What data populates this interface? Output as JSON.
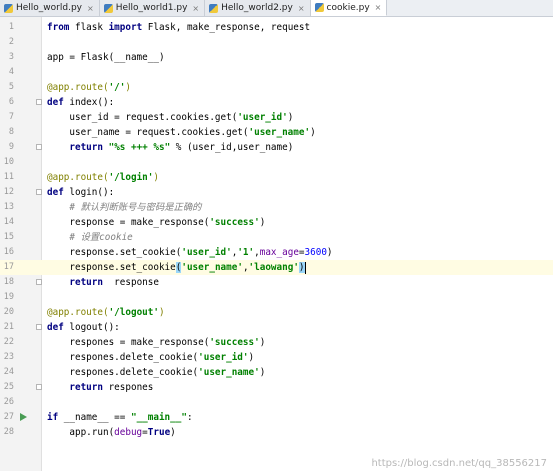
{
  "tabs": [
    {
      "label": "Hello_world.py",
      "active": false
    },
    {
      "label": "Hello_world1.py",
      "active": false
    },
    {
      "label": "Hello_world2.py",
      "active": false
    },
    {
      "label": "cookie.py",
      "active": true
    }
  ],
  "tab_close_glyph": "×",
  "icons": {
    "file_tab": "python-file-icon",
    "run": "run-arrow-icon",
    "fold": "fold-marker-icon"
  },
  "current_line": 17,
  "lines": [
    {
      "n": "1",
      "tokens": [
        {
          "t": "from",
          "c": "kw"
        },
        {
          "t": " flask "
        },
        {
          "t": "import",
          "c": "kw"
        },
        {
          "t": " Flask, make_response, request"
        }
      ]
    },
    {
      "n": "2",
      "tokens": []
    },
    {
      "n": "3",
      "tokens": [
        {
          "t": "app = Flask(__name__)"
        }
      ]
    },
    {
      "n": "4",
      "tokens": []
    },
    {
      "n": "5",
      "tokens": [
        {
          "t": "@app.route(",
          "c": "dec"
        },
        {
          "t": "'/'",
          "c": "str"
        },
        {
          "t": ")",
          "c": "dec"
        }
      ]
    },
    {
      "n": "6",
      "fold": true,
      "tokens": [
        {
          "t": "def",
          "c": "kw"
        },
        {
          "t": " index():"
        }
      ]
    },
    {
      "n": "7",
      "tokens": [
        {
          "t": "    user_id = request.cookies.get("
        },
        {
          "t": "'user_id'",
          "c": "str"
        },
        {
          "t": ")"
        }
      ]
    },
    {
      "n": "8",
      "tokens": [
        {
          "t": "    user_name = request.cookies.get("
        },
        {
          "t": "'user_name'",
          "c": "str"
        },
        {
          "t": ")"
        }
      ]
    },
    {
      "n": "9",
      "fold": true,
      "tokens": [
        {
          "t": "    "
        },
        {
          "t": "return",
          "c": "kw"
        },
        {
          "t": " "
        },
        {
          "t": "\"%s +++ %s\"",
          "c": "str"
        },
        {
          "t": " % (user_id,user_name)"
        }
      ]
    },
    {
      "n": "10",
      "tokens": []
    },
    {
      "n": "11",
      "tokens": [
        {
          "t": "@app.route(",
          "c": "dec"
        },
        {
          "t": "'/login'",
          "c": "str"
        },
        {
          "t": ")",
          "c": "dec"
        }
      ]
    },
    {
      "n": "12",
      "fold": true,
      "tokens": [
        {
          "t": "def",
          "c": "kw"
        },
        {
          "t": " login():"
        }
      ]
    },
    {
      "n": "13",
      "tokens": [
        {
          "t": "    "
        },
        {
          "t": "# 默认判断账号与密码是正确的",
          "c": "cmt"
        }
      ]
    },
    {
      "n": "14",
      "tokens": [
        {
          "t": "    response = make_response("
        },
        {
          "t": "'success'",
          "c": "str"
        },
        {
          "t": ")"
        }
      ]
    },
    {
      "n": "15",
      "tokens": [
        {
          "t": "    "
        },
        {
          "t": "# 设置cookie",
          "c": "cmt"
        }
      ]
    },
    {
      "n": "16",
      "tokens": [
        {
          "t": "    response.set_cookie("
        },
        {
          "t": "'user_id'",
          "c": "str"
        },
        {
          "t": ","
        },
        {
          "t": "'1'",
          "c": "str"
        },
        {
          "t": ","
        },
        {
          "t": "max_age",
          "c": "kwarg"
        },
        {
          "t": "="
        },
        {
          "t": "3600",
          "c": "num"
        },
        {
          "t": ")"
        }
      ]
    },
    {
      "n": "17",
      "tokens": [
        {
          "t": "    response.set_cookie"
        },
        {
          "t": "(",
          "c": "match"
        },
        {
          "t": "'user_name'",
          "c": "str"
        },
        {
          "t": ","
        },
        {
          "t": "'laowang'",
          "c": "str"
        },
        {
          "t": ")",
          "c": "match"
        },
        {
          "caret": true
        }
      ]
    },
    {
      "n": "18",
      "fold": true,
      "tokens": [
        {
          "t": "    "
        },
        {
          "t": "return",
          "c": "kw"
        },
        {
          "t": "  response"
        }
      ]
    },
    {
      "n": "19",
      "tokens": []
    },
    {
      "n": "20",
      "tokens": [
        {
          "t": "@app.route(",
          "c": "dec"
        },
        {
          "t": "'/logout'",
          "c": "str"
        },
        {
          "t": ")",
          "c": "dec"
        }
      ]
    },
    {
      "n": "21",
      "fold": true,
      "tokens": [
        {
          "t": "def",
          "c": "kw"
        },
        {
          "t": " logout():"
        }
      ]
    },
    {
      "n": "22",
      "tokens": [
        {
          "t": "    respones = make_response("
        },
        {
          "t": "'success'",
          "c": "str"
        },
        {
          "t": ")"
        }
      ]
    },
    {
      "n": "23",
      "tokens": [
        {
          "t": "    respones.delete_cookie("
        },
        {
          "t": "'user_id'",
          "c": "str"
        },
        {
          "t": ")"
        }
      ]
    },
    {
      "n": "24",
      "tokens": [
        {
          "t": "    respones.delete_cookie("
        },
        {
          "t": "'user_name'",
          "c": "str"
        },
        {
          "t": ")"
        }
      ]
    },
    {
      "n": "25",
      "fold": true,
      "tokens": [
        {
          "t": "    "
        },
        {
          "t": "return",
          "c": "kw"
        },
        {
          "t": " respones"
        }
      ]
    },
    {
      "n": "26",
      "tokens": []
    },
    {
      "n": "27",
      "run": true,
      "tokens": [
        {
          "t": "if",
          "c": "kw"
        },
        {
          "t": " __name__ == "
        },
        {
          "t": "\"__main__\"",
          "c": "str"
        },
        {
          "t": ":"
        }
      ]
    },
    {
      "n": "28",
      "tokens": [
        {
          "t": "    app.run("
        },
        {
          "t": "debug",
          "c": "kwarg"
        },
        {
          "t": "="
        },
        {
          "t": "True",
          "c": "kw"
        },
        {
          "t": ")"
        }
      ]
    }
  ],
  "watermark": "https://blog.csdn.net/qq_38556217",
  "colors": {
    "keyword": "#000080",
    "string": "#008000",
    "decorator": "#808000",
    "kwarg": "#660099",
    "number": "#0000ff",
    "comment": "#808080",
    "current_line": "#fffce3",
    "run_icon": "#499c54"
  }
}
